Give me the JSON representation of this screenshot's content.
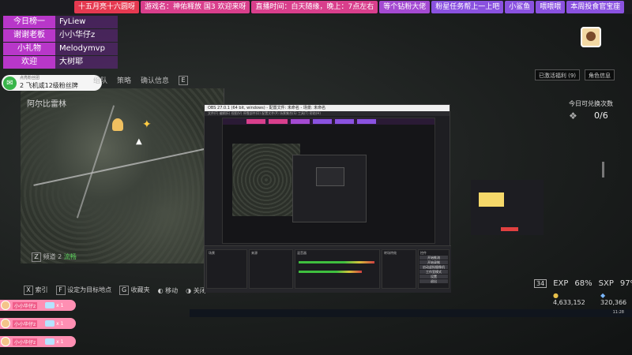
{
  "topbar": {
    "items": [
      {
        "label": "十五月亮十六圆呀",
        "color": "#e53950"
      },
      {
        "label": "游戏名：神佑释放 国3 欢迎来呀",
        "color": "#d93f8c"
      },
      {
        "label": "直播时间：白天随缘，晚上：7点左右",
        "color": "#d93f8c"
      },
      {
        "label": "等个钻粉大佬",
        "color": "#a44ad2"
      },
      {
        "label": "粉星任务帮上一上吧",
        "color": "#8a52e0"
      },
      {
        "label": "小鲨鱼",
        "color": "#8a52e0"
      },
      {
        "label": "喂喂喂",
        "color": "#8a52e0"
      },
      {
        "label": "本周投食官宝座",
        "color": "#8a52e0"
      }
    ]
  },
  "info": {
    "rows": [
      {
        "key": "今日榜一",
        "value": "FyLiew"
      },
      {
        "key": "谢谢老板",
        "value": "小小华仔z"
      },
      {
        "key": "小礼物",
        "value": "Melodymvp"
      },
      {
        "key": "欢迎",
        "value": "大树耶"
      }
    ]
  },
  "badge": {
    "sub": "点亮粉丝团",
    "text": "2 飞机或12级粉丝牌"
  },
  "game": {
    "tabs": [
      "组队",
      "策略",
      "确认信息"
    ],
    "tab_key": "E",
    "top_buttons": [
      "已激活福利 (9)",
      "角色信息"
    ],
    "map_title": "阿尔比雷林",
    "redeem_title": "今日可兑换次数",
    "redeem_count": "0/6",
    "zone_key": "Z",
    "zone_label": "频道 2",
    "zone_status": "流畅",
    "legend": [
      {
        "key": "X",
        "label": "索引"
      },
      {
        "key": "F",
        "label": "设定为目标地点"
      },
      {
        "key": "G",
        "label": "收藏夹"
      },
      {
        "key": "",
        "label": "移动"
      },
      {
        "key": "",
        "label": "关闭"
      }
    ],
    "level": "34",
    "exp_label": "EXP",
    "exp_value": "68%",
    "sxp_label": "SXP",
    "sxp_value": "97%",
    "coins": "4,633,152",
    "gems": "320,366"
  },
  "obs": {
    "title": "OBS 27.0.1 (64 bit, windows) - 配置文件: 未命名 - 场景: 未命名",
    "menu": "文件(F)  编辑(E)  视图(V)  停靠部件(D)  配置文件(P)  场景集合(S)  工具(T)  帮助(H)",
    "docks": [
      "场景",
      "来源",
      "混音器",
      "转场特效",
      "控件"
    ],
    "controls": [
      "开始推流",
      "开始录制",
      "启动虚拟摄像机",
      "工作室模式",
      "设置",
      "退出"
    ]
  },
  "taskbar": {
    "time": "11:28"
  },
  "gifts": [
    {
      "name": "小小华仔z",
      "count": "x 1"
    },
    {
      "name": "小小华仔z",
      "count": "x 1"
    },
    {
      "name": "小小华仔z",
      "count": "x 1"
    }
  ]
}
